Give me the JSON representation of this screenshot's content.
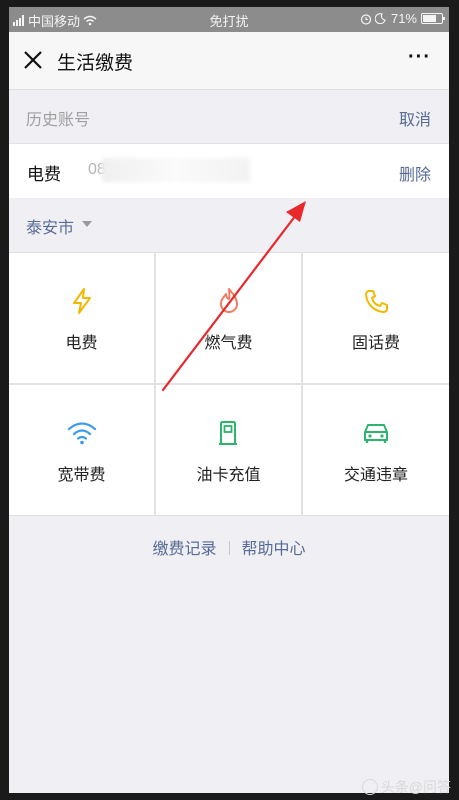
{
  "status_bar": {
    "carrier": "中国移动",
    "mode": "免打扰",
    "battery": "71%",
    "battery_level": 0.71
  },
  "header": {
    "title": "生活缴费",
    "more_label": "···"
  },
  "history": {
    "label": "历史账号",
    "cancel_label": "取消"
  },
  "account": {
    "type": "电费",
    "number_prefix": "08",
    "delete_label": "删除"
  },
  "city": {
    "label": "泰安市"
  },
  "services": [
    {
      "label": "电费",
      "icon": "lightning-icon",
      "color": "#f5b800"
    },
    {
      "label": "燃气费",
      "icon": "flame-icon",
      "color": "#f27c63"
    },
    {
      "label": "固话费",
      "icon": "phone-icon",
      "color": "#f5b800"
    },
    {
      "label": "宽带费",
      "icon": "wifi-icon",
      "color": "#3d9be9"
    },
    {
      "label": "油卡充值",
      "icon": "gas-station-icon",
      "color": "#2db46d"
    },
    {
      "label": "交通违章",
      "icon": "car-icon",
      "color": "#2db46d"
    }
  ],
  "footer": {
    "records_label": "缴费记录",
    "help_label": "帮助中心"
  },
  "colors": {
    "link": "#576b95",
    "annotation_arrow": "#e8282b"
  },
  "watermark": "头条@问答"
}
